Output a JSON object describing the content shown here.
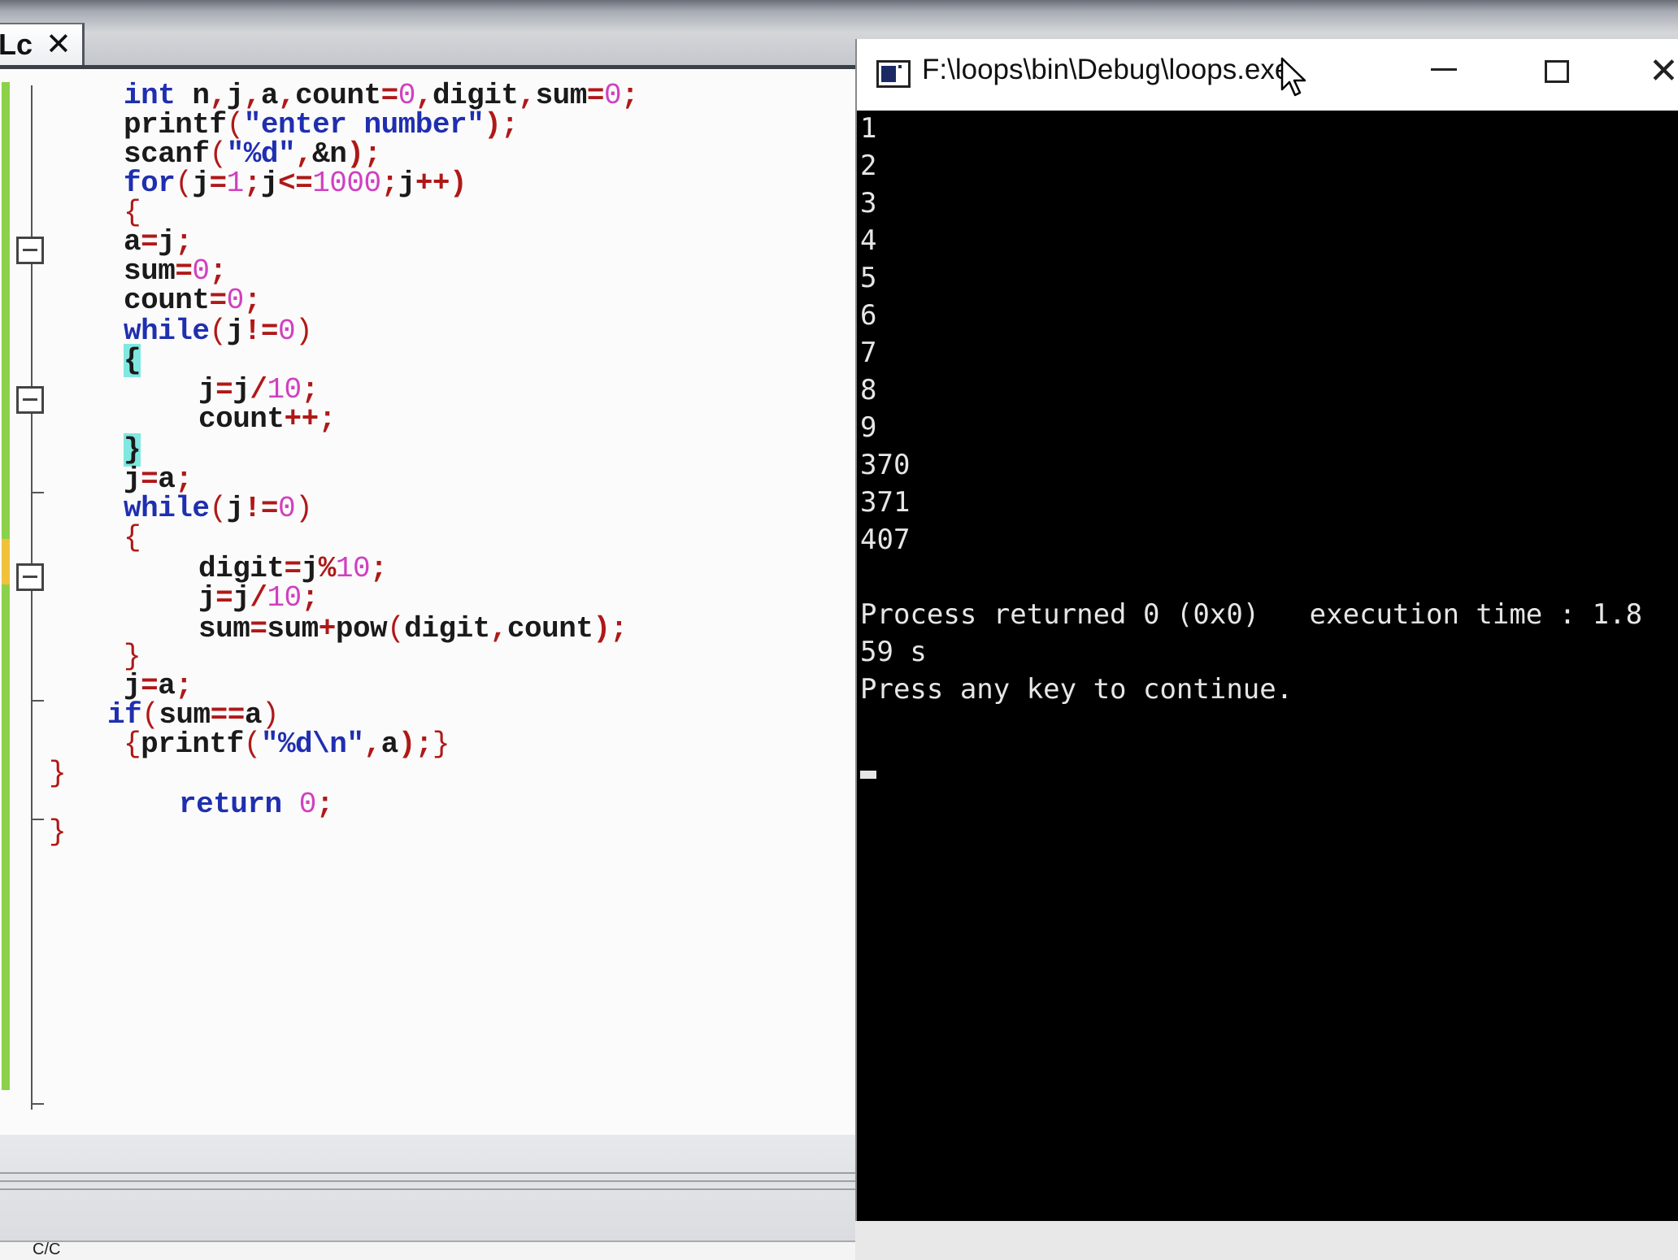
{
  "editor": {
    "tab_label": "Lc",
    "tab_close": "✕",
    "code_lines": [
      [
        {
          "t": "int",
          "c": "kw"
        },
        {
          "t": " n",
          "c": ""
        },
        {
          "t": ",",
          "c": "op"
        },
        {
          "t": "j",
          "c": ""
        },
        {
          "t": ",",
          "c": "op"
        },
        {
          "t": "a",
          "c": ""
        },
        {
          "t": ",",
          "c": "op"
        },
        {
          "t": "count",
          "c": ""
        },
        {
          "t": "=",
          "c": "op"
        },
        {
          "t": "0",
          "c": "num"
        },
        {
          "t": ",",
          "c": "op"
        },
        {
          "t": "digit",
          "c": ""
        },
        {
          "t": ",",
          "c": "op"
        },
        {
          "t": "sum",
          "c": ""
        },
        {
          "t": "=",
          "c": "op"
        },
        {
          "t": "0",
          "c": "num"
        },
        {
          "t": ";",
          "c": "op"
        }
      ],
      [
        {
          "t": "printf",
          "c": ""
        },
        {
          "t": "(",
          "c": "br"
        },
        {
          "t": "\"enter number\"",
          "c": "str"
        },
        {
          "t": ");",
          "c": "op"
        }
      ],
      [
        {
          "t": "scanf",
          "c": ""
        },
        {
          "t": "(",
          "c": "br"
        },
        {
          "t": "\"%d\"",
          "c": "str"
        },
        {
          "t": ",",
          "c": "op"
        },
        {
          "t": "&n",
          "c": ""
        },
        {
          "t": ");",
          "c": "op"
        }
      ],
      [
        {
          "t": "for",
          "c": "kw"
        },
        {
          "t": "(",
          "c": "br"
        },
        {
          "t": "j",
          "c": ""
        },
        {
          "t": "=",
          "c": "op"
        },
        {
          "t": "1",
          "c": "num"
        },
        {
          "t": ";",
          "c": "op"
        },
        {
          "t": "j",
          "c": ""
        },
        {
          "t": "<=",
          "c": "op"
        },
        {
          "t": "1000",
          "c": "num"
        },
        {
          "t": ";",
          "c": "op"
        },
        {
          "t": "j",
          "c": ""
        },
        {
          "t": "++)",
          "c": "op"
        }
      ],
      [
        {
          "t": "{",
          "c": "br"
        }
      ],
      [
        {
          "t": "a",
          "c": ""
        },
        {
          "t": "=",
          "c": "op"
        },
        {
          "t": "j",
          "c": ""
        },
        {
          "t": ";",
          "c": "op"
        }
      ],
      [
        {
          "t": "sum",
          "c": ""
        },
        {
          "t": "=",
          "c": "op"
        },
        {
          "t": "0",
          "c": "num"
        },
        {
          "t": ";",
          "c": "op"
        }
      ],
      [
        {
          "t": "count",
          "c": ""
        },
        {
          "t": "=",
          "c": "op"
        },
        {
          "t": "0",
          "c": "num"
        },
        {
          "t": ";",
          "c": "op"
        }
      ],
      [
        {
          "t": "while",
          "c": "kw"
        },
        {
          "t": "(",
          "c": "br"
        },
        {
          "t": "j",
          "c": ""
        },
        {
          "t": "!=",
          "c": "op"
        },
        {
          "t": "0",
          "c": "num"
        },
        {
          "t": ")",
          "c": "br"
        }
      ],
      [
        {
          "t": "{",
          "c": "hl"
        }
      ],
      [
        {
          "t": "j",
          "c": ""
        },
        {
          "t": "=",
          "c": "op"
        },
        {
          "t": "j",
          "c": ""
        },
        {
          "t": "/",
          "c": "op"
        },
        {
          "t": "10",
          "c": "num"
        },
        {
          "t": ";",
          "c": "op"
        }
      ],
      [
        {
          "t": "count",
          "c": ""
        },
        {
          "t": "++;",
          "c": "op"
        }
      ],
      [
        {
          "t": "}",
          "c": "hl"
        }
      ],
      [
        {
          "t": "j",
          "c": ""
        },
        {
          "t": "=",
          "c": "op"
        },
        {
          "t": "a",
          "c": ""
        },
        {
          "t": ";",
          "c": "op"
        }
      ],
      [
        {
          "t": "while",
          "c": "kw"
        },
        {
          "t": "(",
          "c": "br"
        },
        {
          "t": "j",
          "c": ""
        },
        {
          "t": "!=",
          "c": "op"
        },
        {
          "t": "0",
          "c": "num"
        },
        {
          "t": ")",
          "c": "br"
        }
      ],
      [
        {
          "t": "{",
          "c": "br"
        }
      ],
      [
        {
          "t": "digit",
          "c": ""
        },
        {
          "t": "=",
          "c": "op"
        },
        {
          "t": "j",
          "c": ""
        },
        {
          "t": "%",
          "c": "op"
        },
        {
          "t": "10",
          "c": "num"
        },
        {
          "t": ";",
          "c": "op"
        }
      ],
      [
        {
          "t": "j",
          "c": ""
        },
        {
          "t": "=",
          "c": "op"
        },
        {
          "t": "j",
          "c": ""
        },
        {
          "t": "/",
          "c": "op"
        },
        {
          "t": "10",
          "c": "num"
        },
        {
          "t": ";",
          "c": "op"
        }
      ],
      [
        {
          "t": "sum",
          "c": ""
        },
        {
          "t": "=",
          "c": "op"
        },
        {
          "t": "sum",
          "c": ""
        },
        {
          "t": "+",
          "c": "op"
        },
        {
          "t": "pow",
          "c": ""
        },
        {
          "t": "(",
          "c": "br"
        },
        {
          "t": "digit",
          "c": ""
        },
        {
          "t": ",",
          "c": "op"
        },
        {
          "t": "count",
          "c": ""
        },
        {
          "t": ");",
          "c": "op"
        }
      ],
      [
        {
          "t": "}",
          "c": "br"
        }
      ],
      [
        {
          "t": "j",
          "c": ""
        },
        {
          "t": "=",
          "c": "op"
        },
        {
          "t": "a",
          "c": ""
        },
        {
          "t": ";",
          "c": "op"
        }
      ],
      [
        {
          "t": "if",
          "c": "kw"
        },
        {
          "t": "(",
          "c": "br"
        },
        {
          "t": "sum",
          "c": ""
        },
        {
          "t": "==",
          "c": "op"
        },
        {
          "t": "a",
          "c": ""
        },
        {
          "t": ")",
          "c": "br"
        }
      ],
      [
        {
          "t": "{",
          "c": "br"
        },
        {
          "t": "printf",
          "c": ""
        },
        {
          "t": "(",
          "c": "br"
        },
        {
          "t": "\"%d\\n\"",
          "c": "str"
        },
        {
          "t": ",",
          "c": "op"
        },
        {
          "t": "a",
          "c": ""
        },
        {
          "t": ");",
          "c": "op"
        },
        {
          "t": "}",
          "c": "br"
        }
      ],
      [
        {
          "t": "}",
          "c": "br"
        }
      ],
      [
        {
          "t": "return",
          "c": "kw"
        },
        {
          "t": " ",
          "c": ""
        },
        {
          "t": "0",
          "c": "num"
        },
        {
          "t": ";",
          "c": "op"
        }
      ],
      [
        {
          "t": "}",
          "c": "br"
        }
      ]
    ],
    "status_text": "C/C"
  },
  "console": {
    "title": "F:\\loops\\bin\\Debug\\loops.exe",
    "minimize_glyph": "—",
    "close_glyph": "✕",
    "output_lines": [
      "1",
      "2",
      "3",
      "4",
      "5",
      "6",
      "7",
      "8",
      "9",
      "370",
      "371",
      "407",
      "",
      "Process returned 0 (0x0)   execution time : 1.8",
      "59 s",
      "Press any key to continue."
    ]
  },
  "colors": {
    "keyword": "#1f2fb0",
    "number": "#d040c0",
    "operator": "#b01818",
    "bracket_highlight": "#7fe8e0",
    "console_bg": "#000000",
    "console_text": "#e6e6e6"
  }
}
